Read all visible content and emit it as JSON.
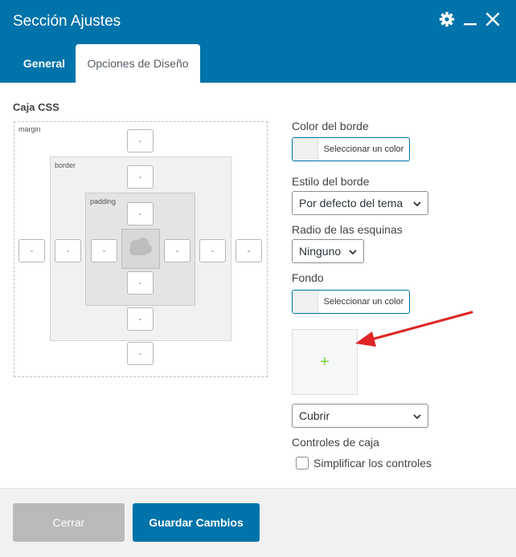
{
  "header": {
    "title": "Sección Ajustes",
    "icons": [
      "gear-icon",
      "minimize-icon",
      "close-icon"
    ]
  },
  "tabs": [
    {
      "label": "General",
      "active": false
    },
    {
      "label": "Opciones de Diseño",
      "active": true
    }
  ],
  "css_box": {
    "label": "Caja CSS",
    "margin_label": "margin",
    "border_label": "border",
    "padding_label": "padding",
    "placeholder": "-",
    "content_icon": "cloud-icon"
  },
  "fields": {
    "border_color": {
      "label": "Color del borde",
      "button": "Seleccionar un color"
    },
    "border_style": {
      "label": "Estilo del borde",
      "value": "Por defecto del tema"
    },
    "corner_radius": {
      "label": "Radio de las esquinas",
      "value": "Ninguno"
    },
    "background": {
      "label": "Fondo",
      "button": "Seleccionar un color"
    },
    "image_add": {
      "symbol": "+"
    },
    "background_size": {
      "value": "Cubrir"
    },
    "box_controls": {
      "label": "Controles de caja",
      "checkbox_label": "Simplificar los controles",
      "checked": false
    }
  },
  "footer": {
    "close_label": "Cerrar",
    "save_label": "Guardar Cambios"
  },
  "colors": {
    "primary": "#0073aa",
    "annotation_arrow": "#e02424",
    "plus": "#7ad03a"
  }
}
